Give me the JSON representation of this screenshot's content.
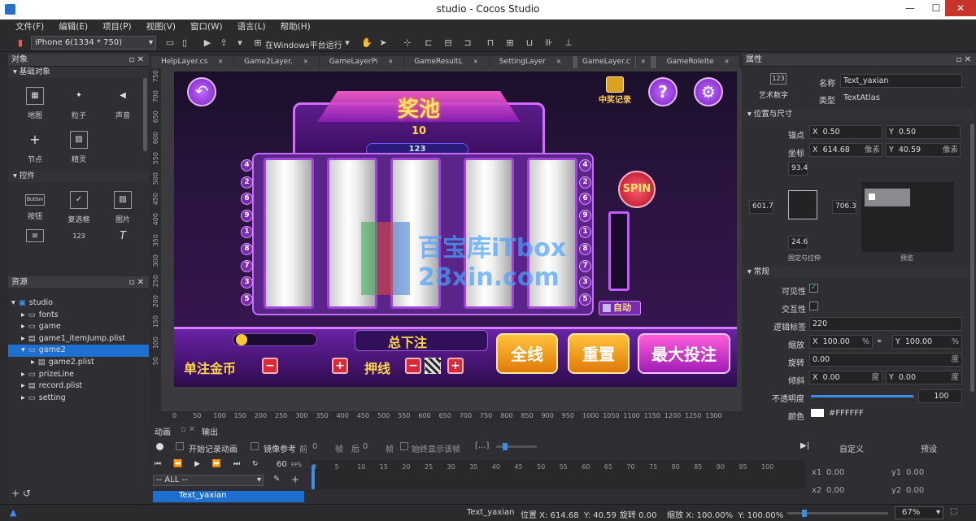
{
  "window": {
    "title": "studio - Cocos Studio",
    "min": "—",
    "max": "☐",
    "close": "✕"
  },
  "menu": [
    "文件(F)",
    "编辑(E)",
    "项目(P)",
    "视图(V)",
    "窗口(W)",
    "语言(L)",
    "帮助(H)"
  ],
  "toolbar": {
    "device": "iPhone 6(1334 * 750)",
    "run_target": "在Windows平台运行"
  },
  "objects_panel": {
    "title": "对象",
    "basic_section": "基础对象",
    "basic_items": [
      {
        "label": "地图",
        "icon": "map-icon",
        "glyph": "▦"
      },
      {
        "label": "粒子",
        "icon": "particle-icon",
        "glyph": "✦"
      },
      {
        "label": "声音",
        "icon": "sound-icon",
        "glyph": "◀"
      },
      {
        "label": "节点",
        "icon": "node-icon",
        "glyph": "+"
      },
      {
        "label": "精灵",
        "icon": "sprite-icon",
        "glyph": "▨"
      }
    ],
    "controls_section": "控件",
    "control_items": [
      {
        "label": "按钮",
        "icon": "button-icon",
        "glyph": "Button"
      },
      {
        "label": "复选框",
        "icon": "checkbox-icon",
        "glyph": "✓"
      },
      {
        "label": "图片",
        "icon": "image-icon",
        "glyph": "▨"
      },
      {
        "label": "",
        "icon": "text-icon",
        "glyph": "≡"
      },
      {
        "label": "",
        "icon": "textatlas-icon",
        "glyph": "123"
      },
      {
        "label": "",
        "icon": "label-icon",
        "glyph": "T"
      }
    ]
  },
  "resources_panel": {
    "title": "资源",
    "tree": [
      {
        "label": "studio",
        "indent": 0,
        "icon": "project-icon",
        "arrow": "▾"
      },
      {
        "label": "fonts",
        "indent": 1,
        "icon": "folder-icon",
        "arrow": "▸"
      },
      {
        "label": "game",
        "indent": 1,
        "icon": "folder-icon",
        "arrow": "▸"
      },
      {
        "label": "game1_itemJump.plist",
        "indent": 1,
        "icon": "plist-icon",
        "arrow": "▸"
      },
      {
        "label": "game2",
        "indent": 1,
        "icon": "folder-icon",
        "arrow": "▾",
        "selected": true
      },
      {
        "label": "game2.plist",
        "indent": 2,
        "icon": "plist-icon",
        "arrow": "▸"
      },
      {
        "label": "prizeLine",
        "indent": 1,
        "icon": "folder-icon",
        "arrow": "▸"
      },
      {
        "label": "record.plist",
        "indent": 1,
        "icon": "plist-icon",
        "arrow": "▸"
      },
      {
        "label": "setting",
        "indent": 1,
        "icon": "folder-icon",
        "arrow": "▸"
      }
    ]
  },
  "editor_tabs": [
    "HelpLayer.cs",
    "Game2Layer.",
    "GameLayerPi",
    "GameResultL",
    "SettingLayer",
    "GameLayer.c",
    "GameRoleIte"
  ],
  "active_tab": 5,
  "canvas": {
    "ruler_x": [
      "0",
      "50",
      "100",
      "150",
      "200",
      "250",
      "300",
      "350",
      "400",
      "450",
      "500",
      "550",
      "600",
      "650",
      "700",
      "750",
      "800",
      "850",
      "900",
      "950",
      "1000",
      "1050",
      "1100",
      "1150",
      "1200",
      "1250",
      "1300"
    ],
    "ruler_y": [
      "750",
      "700",
      "650",
      "600",
      "550",
      "500",
      "450",
      "400",
      "350",
      "300",
      "250",
      "200",
      "150",
      "100",
      "50"
    ],
    "jackpot_title": "奖池",
    "jackpot_value": "10",
    "line_value": "123",
    "record_label": "中奖记录",
    "help_glyph": "?",
    "spin_label": "SPIN",
    "auto_label": "自动",
    "left_numbers": [
      "4",
      "2",
      "6",
      "9",
      "1",
      "8",
      "7",
      "3",
      "5"
    ],
    "right_numbers": [
      "4",
      "2",
      "6",
      "9",
      "1",
      "8",
      "7",
      "3",
      "5"
    ],
    "total_bet": "总下注",
    "single_bet": "单注金币",
    "lines": "押线",
    "all_lines": "全线",
    "reset": "重置",
    "max_bet": "最大投注",
    "minus": "−",
    "plus": "+",
    "watermark_top": "百宝库iTbox",
    "watermark_bottom": "28xin.com"
  },
  "properties": {
    "title": "属性",
    "node_type": "艺术数字",
    "type_glyph": "123",
    "name_label": "名称",
    "name_value": "Text_yaxian",
    "type_label": "类型",
    "type_value": "TextAtlas",
    "pos_section": "位置与尺寸",
    "anchor_label": "锚点",
    "anchor_x": "0.50",
    "anchor_y": "0.50",
    "coord_label": "坐标",
    "coord_x": "614.68",
    "coord_y": "40.59",
    "unit": "像素",
    "x_label": "X",
    "y_label": "Y",
    "margin_top": "93.4",
    "margin_left": "601.7",
    "margin_right": "706.3",
    "margin_bottom": "24.6",
    "fixed_label": "固定与拉伸",
    "preview_label": "预览",
    "general_section": "常规",
    "visible_label": "可见性",
    "interactive_label": "交互性",
    "tag_label": "逻辑标签",
    "tag_value": "220",
    "scale_label": "缩放",
    "scale_x": "100.00",
    "scale_y": "100.00",
    "percent": "%",
    "rotation_label": "旋转",
    "rotation_value": "0.00",
    "degree": "度",
    "skew_label": "倾斜",
    "skew_x": "0.00",
    "skew_y": "0.00",
    "opacity_label": "不透明度",
    "opacity_value": "100",
    "opacity_level": 100,
    "color_label": "颜色",
    "color_value": "#FFFFFF"
  },
  "animation": {
    "tabs": [
      "动画",
      "输出"
    ],
    "record_label": "开始记录动画",
    "mirror_label": "镜像参考",
    "before_label": "前",
    "before_value": "0",
    "frame_unit": "帧",
    "after_label": "后",
    "after_value": "0",
    "show_frames_label": "始终显示该帧",
    "fps": "60",
    "fps_unit": "FPS",
    "filter": "-- ALL --",
    "track": "Text_yaxian",
    "timeline_ticks": [
      "0",
      "5",
      "10",
      "15",
      "20",
      "25",
      "30",
      "35",
      "40",
      "45",
      "50",
      "55",
      "60",
      "65",
      "70",
      "75",
      "80",
      "85",
      "90",
      "95",
      "100"
    ],
    "custom_tab": "自定义",
    "preset_tab": "预设",
    "x1_label": "x1",
    "x1": "0.00",
    "y1_label": "y1",
    "y1": "0.00",
    "x2_label": "x2",
    "x2": "0.00",
    "y2_label": "y2",
    "y2": "0.00"
  },
  "status": {
    "name": "Text_yaxian",
    "position": "位置 X: 614.68  Y: 40.59",
    "rotation": "旋转 0.00",
    "scale": "缩放 X: 100.00%  Y: 100.00%",
    "zoom": "67%"
  },
  "colors": {
    "accent": "#007acc",
    "selection": "#1e6fd0",
    "purple": "#9b36d8"
  }
}
